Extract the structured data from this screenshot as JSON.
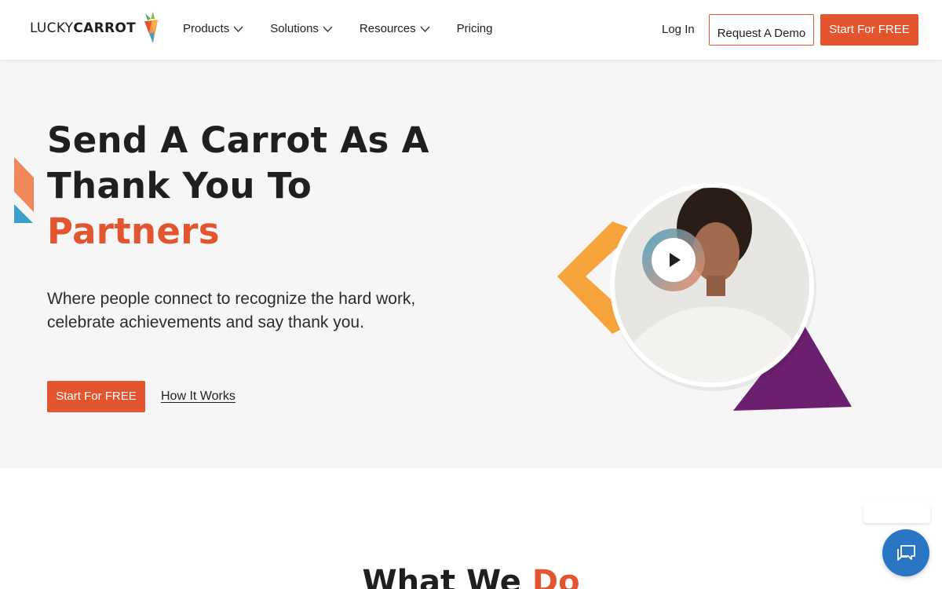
{
  "brand": {
    "logo_word1": "LUCKY",
    "logo_word2": "CARROT",
    "accent_color": "#e2552f",
    "chat_color": "#2a76c4"
  },
  "nav": {
    "items": [
      {
        "label": "Products",
        "has_dropdown": true
      },
      {
        "label": "Solutions",
        "has_dropdown": true
      },
      {
        "label": "Resources",
        "has_dropdown": true
      },
      {
        "label": "Pricing",
        "has_dropdown": false
      }
    ],
    "login": "Log In",
    "demo": "Request A Demo",
    "start_free": "Start For FREE"
  },
  "hero": {
    "title_line1": "Send A Carrot As A",
    "title_line2": "Thank You To",
    "title_accent": "Partners",
    "subtitle": "Where people connect to recognize the hard work, celebrate achievements and say thank you.",
    "primary_button": "Start For FREE",
    "secondary_link": "How It Works",
    "video_icon": "play-icon"
  },
  "section2": {
    "title_part1": "What We",
    "title_accent": "Do"
  },
  "chat": {
    "icon": "chat-icon"
  }
}
